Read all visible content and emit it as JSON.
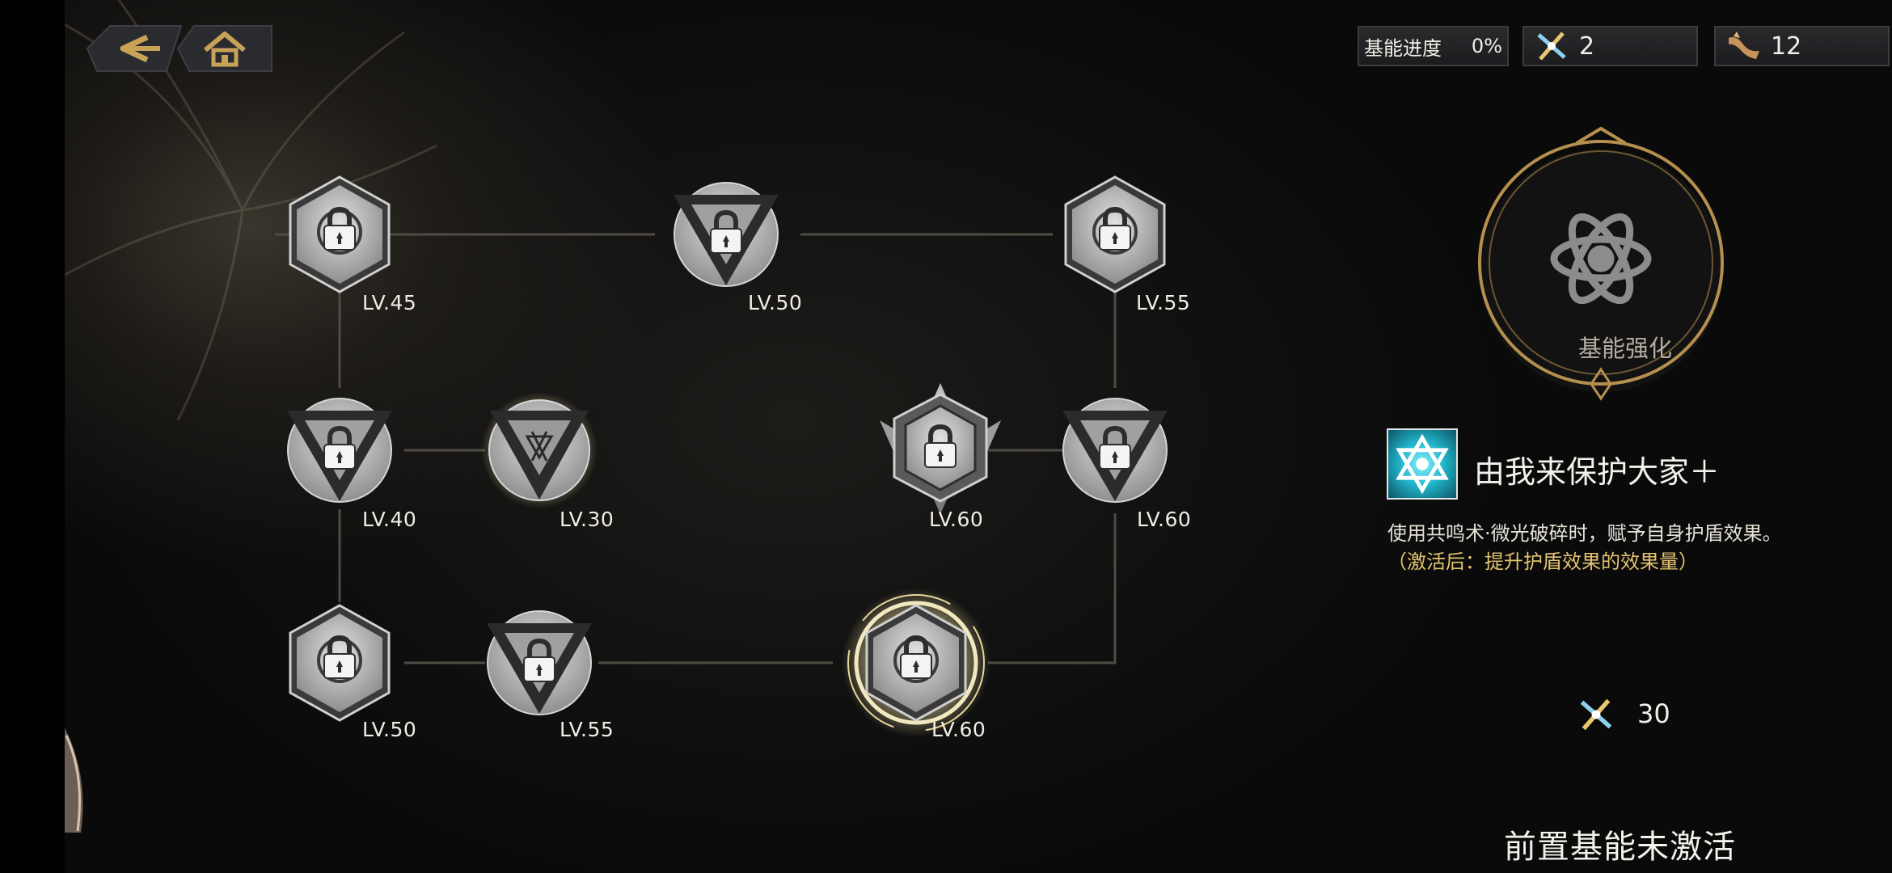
{
  "progress": {
    "label": "基能进度",
    "value": "0%"
  },
  "resources": [
    {
      "icon": "crystal-cross-icon",
      "value": "2"
    },
    {
      "icon": "bird-token-icon",
      "value": "12"
    }
  ],
  "tree": {
    "nodes": [
      {
        "level": "LV.45",
        "shape": "hexagon",
        "state": "locked"
      },
      {
        "level": "LV.50",
        "shape": "triangle-circle",
        "state": "locked"
      },
      {
        "level": "LV.55",
        "shape": "hexagon",
        "state": "locked"
      },
      {
        "level": "LV.40",
        "shape": "triangle-circle",
        "state": "locked"
      },
      {
        "level": "LV.30",
        "shape": "triangle-circle",
        "state": "available"
      },
      {
        "level": "LV.60",
        "shape": "winged-hexagon",
        "state": "locked"
      },
      {
        "level": "LV.60",
        "shape": "triangle-circle",
        "state": "locked"
      },
      {
        "level": "LV.50",
        "shape": "hexagon",
        "state": "locked"
      },
      {
        "level": "LV.55",
        "shape": "triangle-circle",
        "state": "locked"
      },
      {
        "level": "LV.60",
        "shape": "hexagon",
        "state": "selected"
      }
    ]
  },
  "panel": {
    "emblem_label": "基能强化",
    "skill_title": "由我来保护大家＋",
    "skill_desc": "使用共鸣术·微光破碎时，赋予自身护盾效果。",
    "skill_note": "（激活后：提升护盾效果的效果量）",
    "cost": "30",
    "status": "前置基能未激活"
  },
  "colors": {
    "gold": "#c9a25a",
    "highlight": "#e6d79a",
    "cyan": "#4fd8ea"
  }
}
